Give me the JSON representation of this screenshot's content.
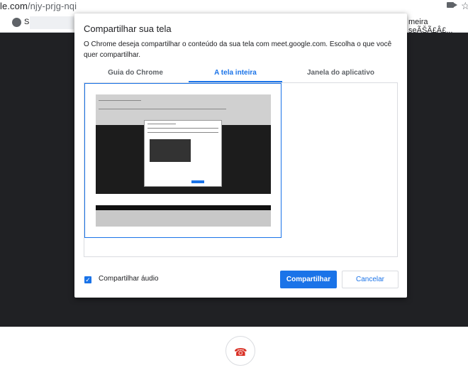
{
  "browser": {
    "url_host": "le.com",
    "url_path": "/njy-prjg-nqi",
    "bookmark_letter": "S",
    "bookmark_right": "meira seÃŠÃ£Â£..."
  },
  "dialog": {
    "title": "Compartilhar sua tela",
    "description": "O Chrome deseja compartilhar o conteúdo da sua tela com meet.google.com. Escolha o que você quer compartilhar.",
    "tabs": [
      {
        "label": "Guia do Chrome",
        "active": false
      },
      {
        "label": "A tela inteira",
        "active": true
      },
      {
        "label": "Janela do aplicativo",
        "active": false
      }
    ],
    "share_audio": {
      "label": "Compartilhar áudio",
      "checked": true
    },
    "share_button": "Compartilhar",
    "cancel_button": "Cancelar"
  },
  "colors": {
    "accent": "#1a73e8",
    "stage": "#202124",
    "hangup": "#d93025"
  },
  "icons": [
    "globe-icon",
    "camera-icon",
    "star-icon",
    "check-icon",
    "hang-up-icon"
  ]
}
